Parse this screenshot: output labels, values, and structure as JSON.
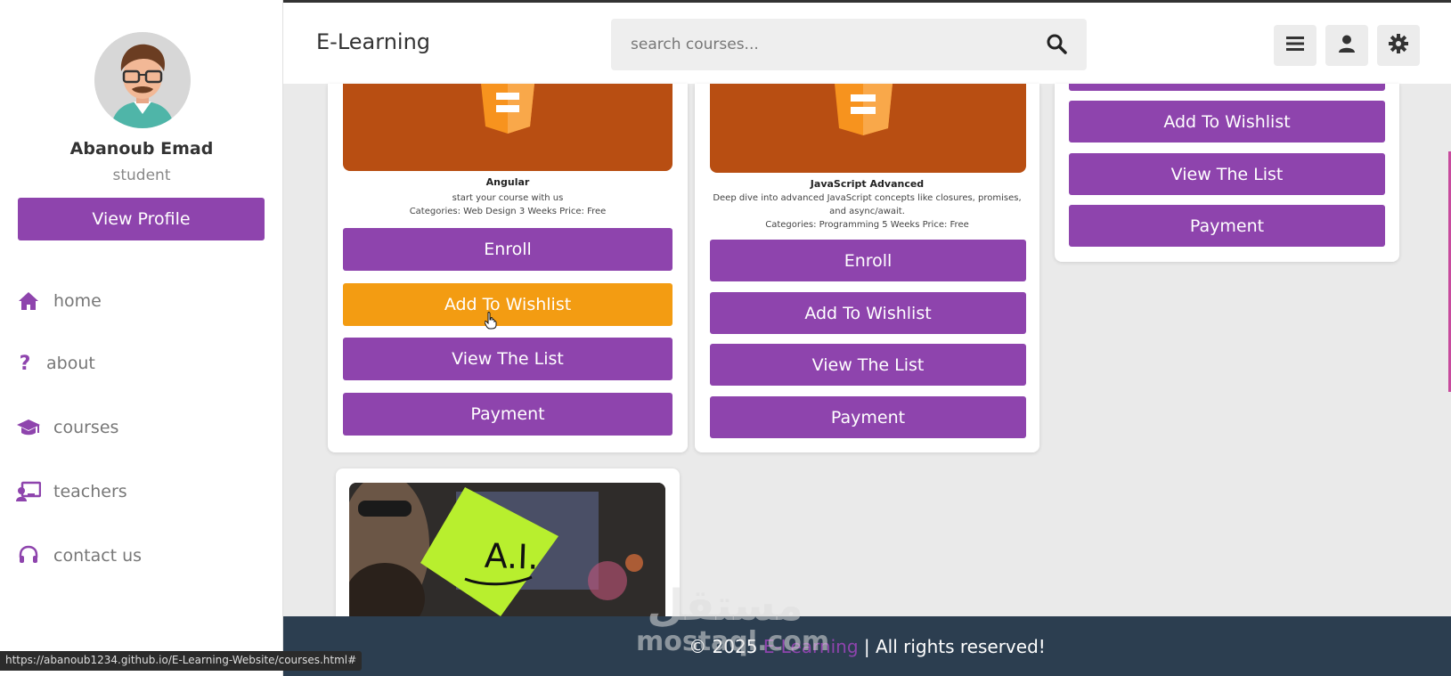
{
  "header": {
    "logo": "E-Learning",
    "search_placeholder": "search courses..."
  },
  "sidebar": {
    "user_name": "Abanoub Emad",
    "user_role": "student",
    "profile_button": "View Profile",
    "items": [
      {
        "label": "home",
        "icon": "home-icon"
      },
      {
        "label": "about",
        "icon": "question-icon"
      },
      {
        "label": "courses",
        "icon": "graduation-cap-icon"
      },
      {
        "label": "teachers",
        "icon": "chalkboard-teacher-icon"
      },
      {
        "label": "contact us",
        "icon": "headset-icon"
      }
    ]
  },
  "courses": [
    {
      "title": "Angular",
      "description": "start your course with us",
      "meta": "Categories: Web Design 3 Weeks Price: Free",
      "buttons": [
        "Enroll",
        "Add To Wishlist",
        "View The List",
        "Payment"
      ]
    },
    {
      "title": "JavaScript Advanced",
      "description": "Deep dive into advanced JavaScript concepts like closures, promises, and async/await.",
      "meta": "Categories: Programming 5 Weeks Price: Free",
      "buttons": [
        "Enroll",
        "Add To Wishlist",
        "View The List",
        "Payment"
      ]
    },
    {
      "buttons": [
        "Add To Wishlist",
        "View The List",
        "Payment"
      ]
    },
    {
      "image_text": "A.I."
    }
  ],
  "footer": {
    "copyright": "© 2025",
    "brand": "E-Learning",
    "rights": "| All rights reserved!"
  },
  "status_bar": {
    "url": "https://abanoub1234.github.io/E-Learning-Website/courses.html#"
  },
  "watermark": {
    "arabic": "مستقل",
    "latin": "mostaql.com"
  },
  "colors": {
    "accent": "#8e44ad",
    "hover": "#f39c12",
    "footer_bg": "#2c3e50",
    "thumb": "#b84e12"
  }
}
